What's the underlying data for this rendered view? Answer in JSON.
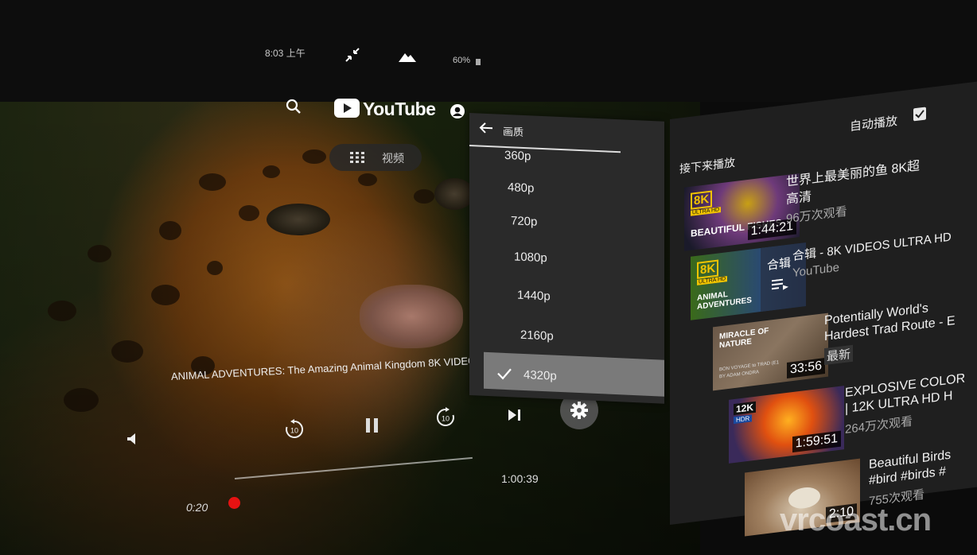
{
  "status": {
    "time": "8:03 上午",
    "battery": "60%",
    "icons": [
      "collapse-icon",
      "mountains-icon",
      "battery-icon"
    ]
  },
  "header": {
    "brand": "YouTube",
    "videos_label": "视频",
    "icons": [
      "search-icon",
      "account-icon",
      "grid-icon"
    ]
  },
  "player": {
    "title": "ANIMAL ADVENTURES: The Amazing Animal Kingdom 8K VIDEO",
    "elapsed": "0:20",
    "duration": "1:00:39",
    "progress_fraction": 0.0055,
    "controls": [
      "volume-icon",
      "rewind-10-icon",
      "pause-icon",
      "forward-10-icon",
      "skip-next-icon",
      "settings-icon"
    ],
    "rewind_label": "10",
    "forward_label": "10"
  },
  "quality_menu": {
    "title": "画质",
    "options": [
      "360p",
      "480p",
      "720p",
      "1080p",
      "1440p",
      "2160p",
      "4320p"
    ],
    "selected": "4320p"
  },
  "up_next": {
    "heading": "接下来播放",
    "autoplay_label": "自动播放",
    "autoplay_checked": true,
    "items": [
      {
        "badge": "8K",
        "badge_sub": "ULTRA HD",
        "thumb_text": "BEAUTIFUL FISHES",
        "duration": "1:44:21",
        "title": "世界上最美丽的鱼 8K超",
        "title2": "高清",
        "sub": "96万次观看"
      },
      {
        "badge": "8K",
        "badge_sub": "ULTRA HD",
        "thumb_text": "ANIMAL ADVENTURES",
        "overlay": "合辑",
        "title": "合辑 - 8K VIDEOS ULTRA HD",
        "title2": "",
        "sub": "YouTube"
      },
      {
        "badge": "",
        "badge_sub": "",
        "thumb_text": "MIRACLE OF NATURE",
        "thumb_small": "BON VOYAGE to TRAD (E1",
        "thumb_small2": "BY ADAM ONDRA",
        "duration": "33:56",
        "title": "Potentially World's",
        "title2": "Hardest Trad Route - E",
        "sub": "最新"
      },
      {
        "badge": "12K",
        "badge_sub": "HDR",
        "thumb_text": "",
        "duration": "1:59:51",
        "title": "EXPLOSIVE COLOR",
        "title2": "| 12K ULTRA HD H",
        "sub": "264万次观看"
      },
      {
        "badge": "",
        "badge_sub": "",
        "thumb_text": "",
        "duration": "2:10",
        "title": "Beautiful Birds",
        "title2": "#bird #birds #",
        "sub": "755次观看"
      }
    ]
  },
  "watermark": "vrcoast.cn",
  "colors": {
    "accent": "#e51212",
    "panel": "#1f1f1f",
    "menu": "#2a2a2a",
    "selected": "#7a7a7a"
  }
}
